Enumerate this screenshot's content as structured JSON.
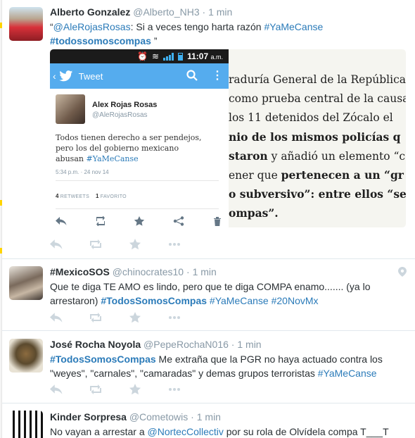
{
  "tweets": [
    {
      "name": "Alberto Gonzalez",
      "handle": "@Alberto_NH3",
      "time": "1 min",
      "line1_mention": "@AleRojasRosas",
      "line1_text": ": Si a veces tengo harta razón ",
      "line1_tag": "#YaMeCanse",
      "line2_tag": "#todossomoscompas",
      "line2_text": " ”",
      "media": {
        "status_time": "11:07",
        "status_ampm": "a.m.",
        "app_title": "Tweet",
        "inner_name": "Alex Rojas Rosas",
        "inner_handle": "@AleRojasRosas",
        "inner_text_1": "Todos tienen derecho a ser pendejos,",
        "inner_text_2": "pero los del gobierno mexicano",
        "inner_text_3": "abusan ",
        "inner_tag": "#YaMeCanse",
        "inner_time": "5:34 p.m. · 24 nov 14",
        "retweets_count": "4",
        "retweets_label": "RETWEETS",
        "favorites_count": "1",
        "favorites_label": "FAVORITO",
        "article_lines": [
          [
            "raduría General de la República (",
            ""
          ],
          [
            "como prueba central de la causa",
            ""
          ],
          [
            "los 11 detenidos del Zócalo el",
            ""
          ],
          [
            "",
            "nio de los mismos policías q"
          ],
          [
            "",
            "staron",
            " y añadió un elemento “c"
          ],
          [
            "ener que ",
            "pertenecen a un “gr"
          ],
          [
            "",
            "o subversivo”: entre ellos “se"
          ],
          [
            "",
            "ompas”."
          ]
        ]
      }
    },
    {
      "name": "#MexicoSOS",
      "handle": "@chinocrates10",
      "time": "1 min",
      "text": "Que te diga TE AMO es lindo, pero que te diga COMPA enamo....... (ya lo arrestaron) ",
      "tag1": "#TodosSomosCompas",
      "tag2": "#YaMeCanse",
      "tag3": "#20NovMx"
    },
    {
      "name": "José Rocha Noyola",
      "handle": "@PepeRochaN016",
      "time": "1 min",
      "tag1": "#TodosSomosCompas",
      "text": " Me extraña que la PGR no haya actuado contra los \"weyes\", \"carnales\", \"camaradas\" y demas grupos terroristas ",
      "tag2": "#YaMeCanse"
    },
    {
      "name": "Kinder Sorpresa",
      "handle": "@Cometowis",
      "time": "1 min",
      "text_pre": "No  vayan a arrestar a ",
      "mention": "@NortecCollectiv",
      "text_post": " por su rola de Olvídela compa T___T"
    }
  ],
  "separator": "·"
}
